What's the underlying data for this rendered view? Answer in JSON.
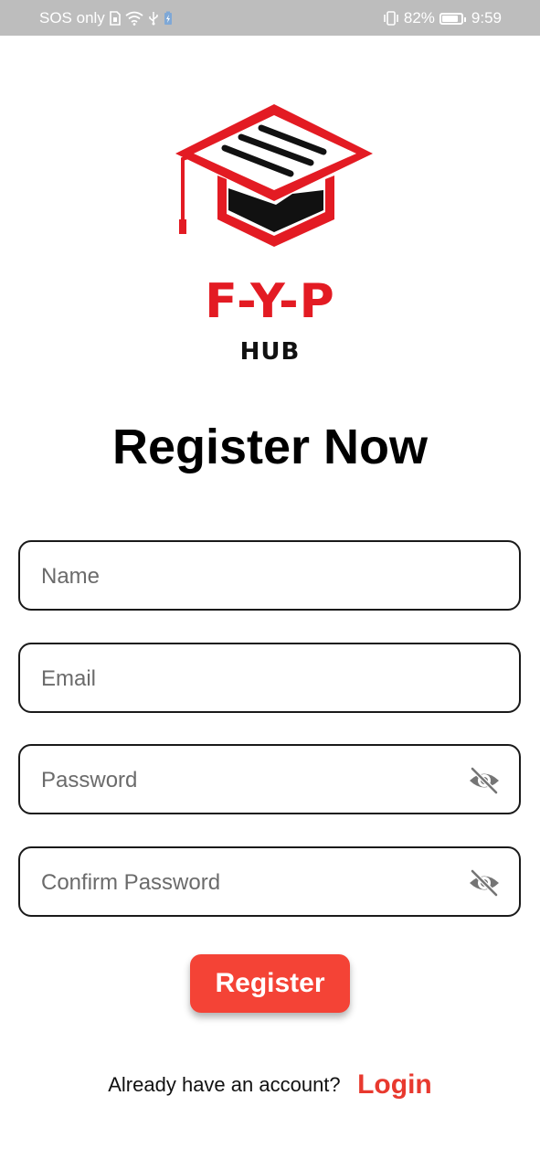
{
  "status_bar": {
    "carrier": "SOS only",
    "battery_percent": "82%",
    "time": "9:59",
    "icons": [
      "sim-icon",
      "wifi-icon",
      "usb-icon",
      "battery-saver-icon",
      "vibrate-icon",
      "battery-icon"
    ]
  },
  "brand": {
    "logo_icon": "graduation-cap-logo-icon",
    "name": "F-Y-P",
    "subtitle": "HUB",
    "accent_color": "#e31b23"
  },
  "page": {
    "title": "Register Now"
  },
  "form": {
    "name_placeholder": "Name",
    "email_placeholder": "Email",
    "password_placeholder": "Password",
    "confirm_password_placeholder": "Confirm Password",
    "visibility_icon": "eye-off-icon",
    "register_label": "Register",
    "button_color": "#f44336"
  },
  "footer": {
    "prompt": "Already have an account?",
    "login_label": "Login"
  }
}
